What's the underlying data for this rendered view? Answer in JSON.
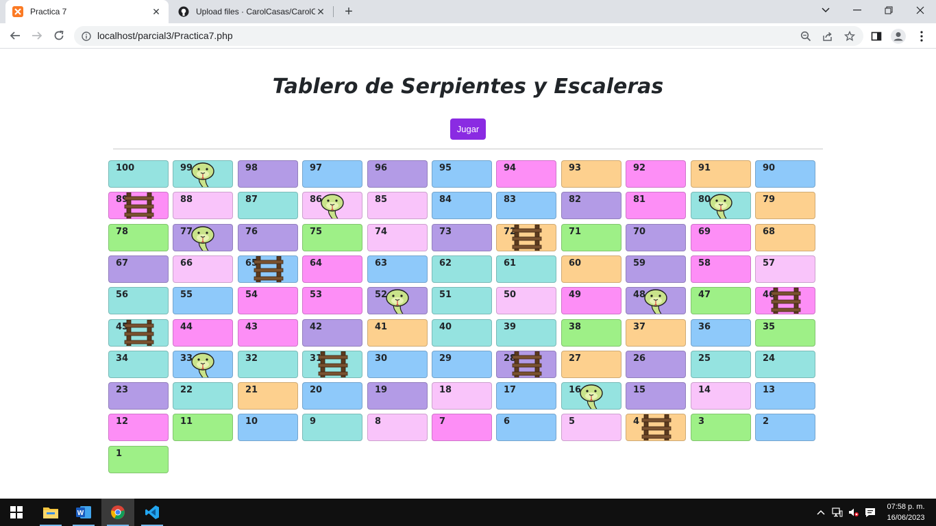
{
  "browser": {
    "tabs": [
      {
        "label": "Practica 7",
        "active": true
      },
      {
        "label": "Upload files · CarolCasas/CarolCa",
        "active": false
      }
    ],
    "url": "localhost/parcial3/Practica7.php"
  },
  "page": {
    "title": "Tablero de Serpientes y Escaleras",
    "play_button": "Jugar"
  },
  "palette": {
    "teal": "#95e3e0",
    "blue": "#8ec9fa",
    "purple": "#b39be6",
    "magenta": "#fd8ef6",
    "peach": "#fdd08e",
    "pink": "#f9c4fa",
    "green": "#9ef087"
  },
  "board": {
    "rows": [
      [
        {
          "n": "100",
          "color": "teal"
        },
        {
          "n": "99",
          "color": "teal",
          "icon": "snake"
        },
        {
          "n": "98",
          "color": "purple"
        },
        {
          "n": "97",
          "color": "blue"
        },
        {
          "n": "96",
          "color": "purple"
        },
        {
          "n": "95",
          "color": "blue"
        },
        {
          "n": "94",
          "color": "magenta"
        },
        {
          "n": "93",
          "color": "peach"
        },
        {
          "n": "92",
          "color": "magenta"
        },
        {
          "n": "91",
          "color": "peach"
        },
        {
          "n": "90",
          "color": "blue"
        }
      ],
      [
        {
          "n": "89",
          "color": "magenta",
          "icon": "ladder"
        },
        {
          "n": "88",
          "color": "pink"
        },
        {
          "n": "87",
          "color": "teal"
        },
        {
          "n": "86",
          "color": "pink",
          "icon": "snake"
        },
        {
          "n": "85",
          "color": "pink"
        },
        {
          "n": "84",
          "color": "blue"
        },
        {
          "n": "83",
          "color": "blue"
        },
        {
          "n": "82",
          "color": "purple"
        },
        {
          "n": "81",
          "color": "magenta"
        },
        {
          "n": "80",
          "color": "teal",
          "icon": "snake"
        },
        {
          "n": "79",
          "color": "peach"
        }
      ],
      [
        {
          "n": "78",
          "color": "green"
        },
        {
          "n": "77",
          "color": "purple",
          "icon": "snake"
        },
        {
          "n": "76",
          "color": "purple"
        },
        {
          "n": "75",
          "color": "green"
        },
        {
          "n": "74",
          "color": "pink"
        },
        {
          "n": "73",
          "color": "purple"
        },
        {
          "n": "72",
          "color": "peach",
          "icon": "ladder"
        },
        {
          "n": "71",
          "color": "green"
        },
        {
          "n": "70",
          "color": "purple"
        },
        {
          "n": "69",
          "color": "magenta"
        },
        {
          "n": "68",
          "color": "peach"
        }
      ],
      [
        {
          "n": "67",
          "color": "purple"
        },
        {
          "n": "66",
          "color": "pink"
        },
        {
          "n": "65",
          "color": "blue",
          "icon": "ladder"
        },
        {
          "n": "64",
          "color": "magenta"
        },
        {
          "n": "63",
          "color": "blue"
        },
        {
          "n": "62",
          "color": "teal"
        },
        {
          "n": "61",
          "color": "teal"
        },
        {
          "n": "60",
          "color": "peach"
        },
        {
          "n": "59",
          "color": "purple"
        },
        {
          "n": "58",
          "color": "magenta"
        },
        {
          "n": "57",
          "color": "pink"
        }
      ],
      [
        {
          "n": "56",
          "color": "teal"
        },
        {
          "n": "55",
          "color": "blue"
        },
        {
          "n": "54",
          "color": "magenta"
        },
        {
          "n": "53",
          "color": "magenta"
        },
        {
          "n": "52",
          "color": "purple",
          "icon": "snake"
        },
        {
          "n": "51",
          "color": "teal"
        },
        {
          "n": "50",
          "color": "pink"
        },
        {
          "n": "49",
          "color": "magenta"
        },
        {
          "n": "48",
          "color": "purple",
          "icon": "snake"
        },
        {
          "n": "47",
          "color": "green"
        },
        {
          "n": "46",
          "color": "magenta",
          "icon": "ladder"
        }
      ],
      [
        {
          "n": "45",
          "color": "teal",
          "icon": "ladder"
        },
        {
          "n": "44",
          "color": "magenta"
        },
        {
          "n": "43",
          "color": "magenta"
        },
        {
          "n": "42",
          "color": "purple"
        },
        {
          "n": "41",
          "color": "peach"
        },
        {
          "n": "40",
          "color": "teal"
        },
        {
          "n": "39",
          "color": "teal"
        },
        {
          "n": "38",
          "color": "green"
        },
        {
          "n": "37",
          "color": "peach"
        },
        {
          "n": "36",
          "color": "blue"
        },
        {
          "n": "35",
          "color": "green"
        }
      ],
      [
        {
          "n": "34",
          "color": "teal"
        },
        {
          "n": "33",
          "color": "blue",
          "icon": "snake"
        },
        {
          "n": "32",
          "color": "teal"
        },
        {
          "n": "31",
          "color": "teal",
          "icon": "ladder"
        },
        {
          "n": "30",
          "color": "blue"
        },
        {
          "n": "29",
          "color": "blue"
        },
        {
          "n": "28",
          "color": "purple",
          "icon": "ladder"
        },
        {
          "n": "27",
          "color": "peach"
        },
        {
          "n": "26",
          "color": "purple"
        },
        {
          "n": "25",
          "color": "teal"
        },
        {
          "n": "24",
          "color": "teal"
        }
      ],
      [
        {
          "n": "23",
          "color": "purple"
        },
        {
          "n": "22",
          "color": "teal"
        },
        {
          "n": "21",
          "color": "peach"
        },
        {
          "n": "20",
          "color": "blue"
        },
        {
          "n": "19",
          "color": "purple"
        },
        {
          "n": "18",
          "color": "pink"
        },
        {
          "n": "17",
          "color": "blue"
        },
        {
          "n": "16",
          "color": "teal",
          "icon": "snake"
        },
        {
          "n": "15",
          "color": "purple"
        },
        {
          "n": "14",
          "color": "pink"
        },
        {
          "n": "13",
          "color": "blue"
        }
      ],
      [
        {
          "n": "12",
          "color": "magenta"
        },
        {
          "n": "11",
          "color": "green"
        },
        {
          "n": "10",
          "color": "blue"
        },
        {
          "n": "9",
          "color": "teal"
        },
        {
          "n": "8",
          "color": "pink"
        },
        {
          "n": "7",
          "color": "magenta"
        },
        {
          "n": "6",
          "color": "blue"
        },
        {
          "n": "5",
          "color": "pink"
        },
        {
          "n": "4",
          "color": "peach",
          "icon": "ladder"
        },
        {
          "n": "3",
          "color": "green"
        },
        {
          "n": "2",
          "color": "blue"
        }
      ],
      [
        {
          "n": "1",
          "color": "green"
        }
      ]
    ]
  },
  "taskbar": {
    "apps": [
      "windows-start-icon",
      "file-explorer-icon",
      "word-icon",
      "chrome-icon",
      "vscode-icon"
    ],
    "time": "07:58 p. m.",
    "date": "16/06/2023"
  }
}
